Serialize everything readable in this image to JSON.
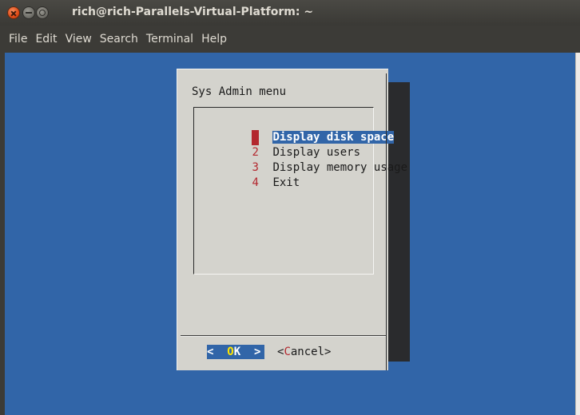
{
  "window": {
    "title": "rich@rich-Parallels-Virtual-Platform: ~"
  },
  "menubar": {
    "items": [
      "File",
      "Edit",
      "View",
      "Search",
      "Terminal",
      "Help"
    ]
  },
  "dialog": {
    "title": "Sys Admin menu",
    "items": [
      {
        "tag": "1",
        "label": "Display disk space",
        "selected": true
      },
      {
        "tag": "2",
        "label": "Display users",
        "selected": false
      },
      {
        "tag": "3",
        "label": "Display memory usage",
        "selected": false
      },
      {
        "tag": "4",
        "label": "Exit",
        "selected": false
      }
    ],
    "ok_button": {
      "left": "<",
      "hotkey": "O",
      "rest": "K",
      "right": ">"
    },
    "cancel_button": {
      "left": "<",
      "hotkey": "C",
      "rest": "ancel",
      "right": ">"
    }
  },
  "colors": {
    "terminal_bg": "#3165a8",
    "dialog_bg": "#d4d3cd",
    "shadow": "#2a2b2d",
    "tag_red": "#b3272e",
    "hotkey_yellow": "#ffe600"
  }
}
